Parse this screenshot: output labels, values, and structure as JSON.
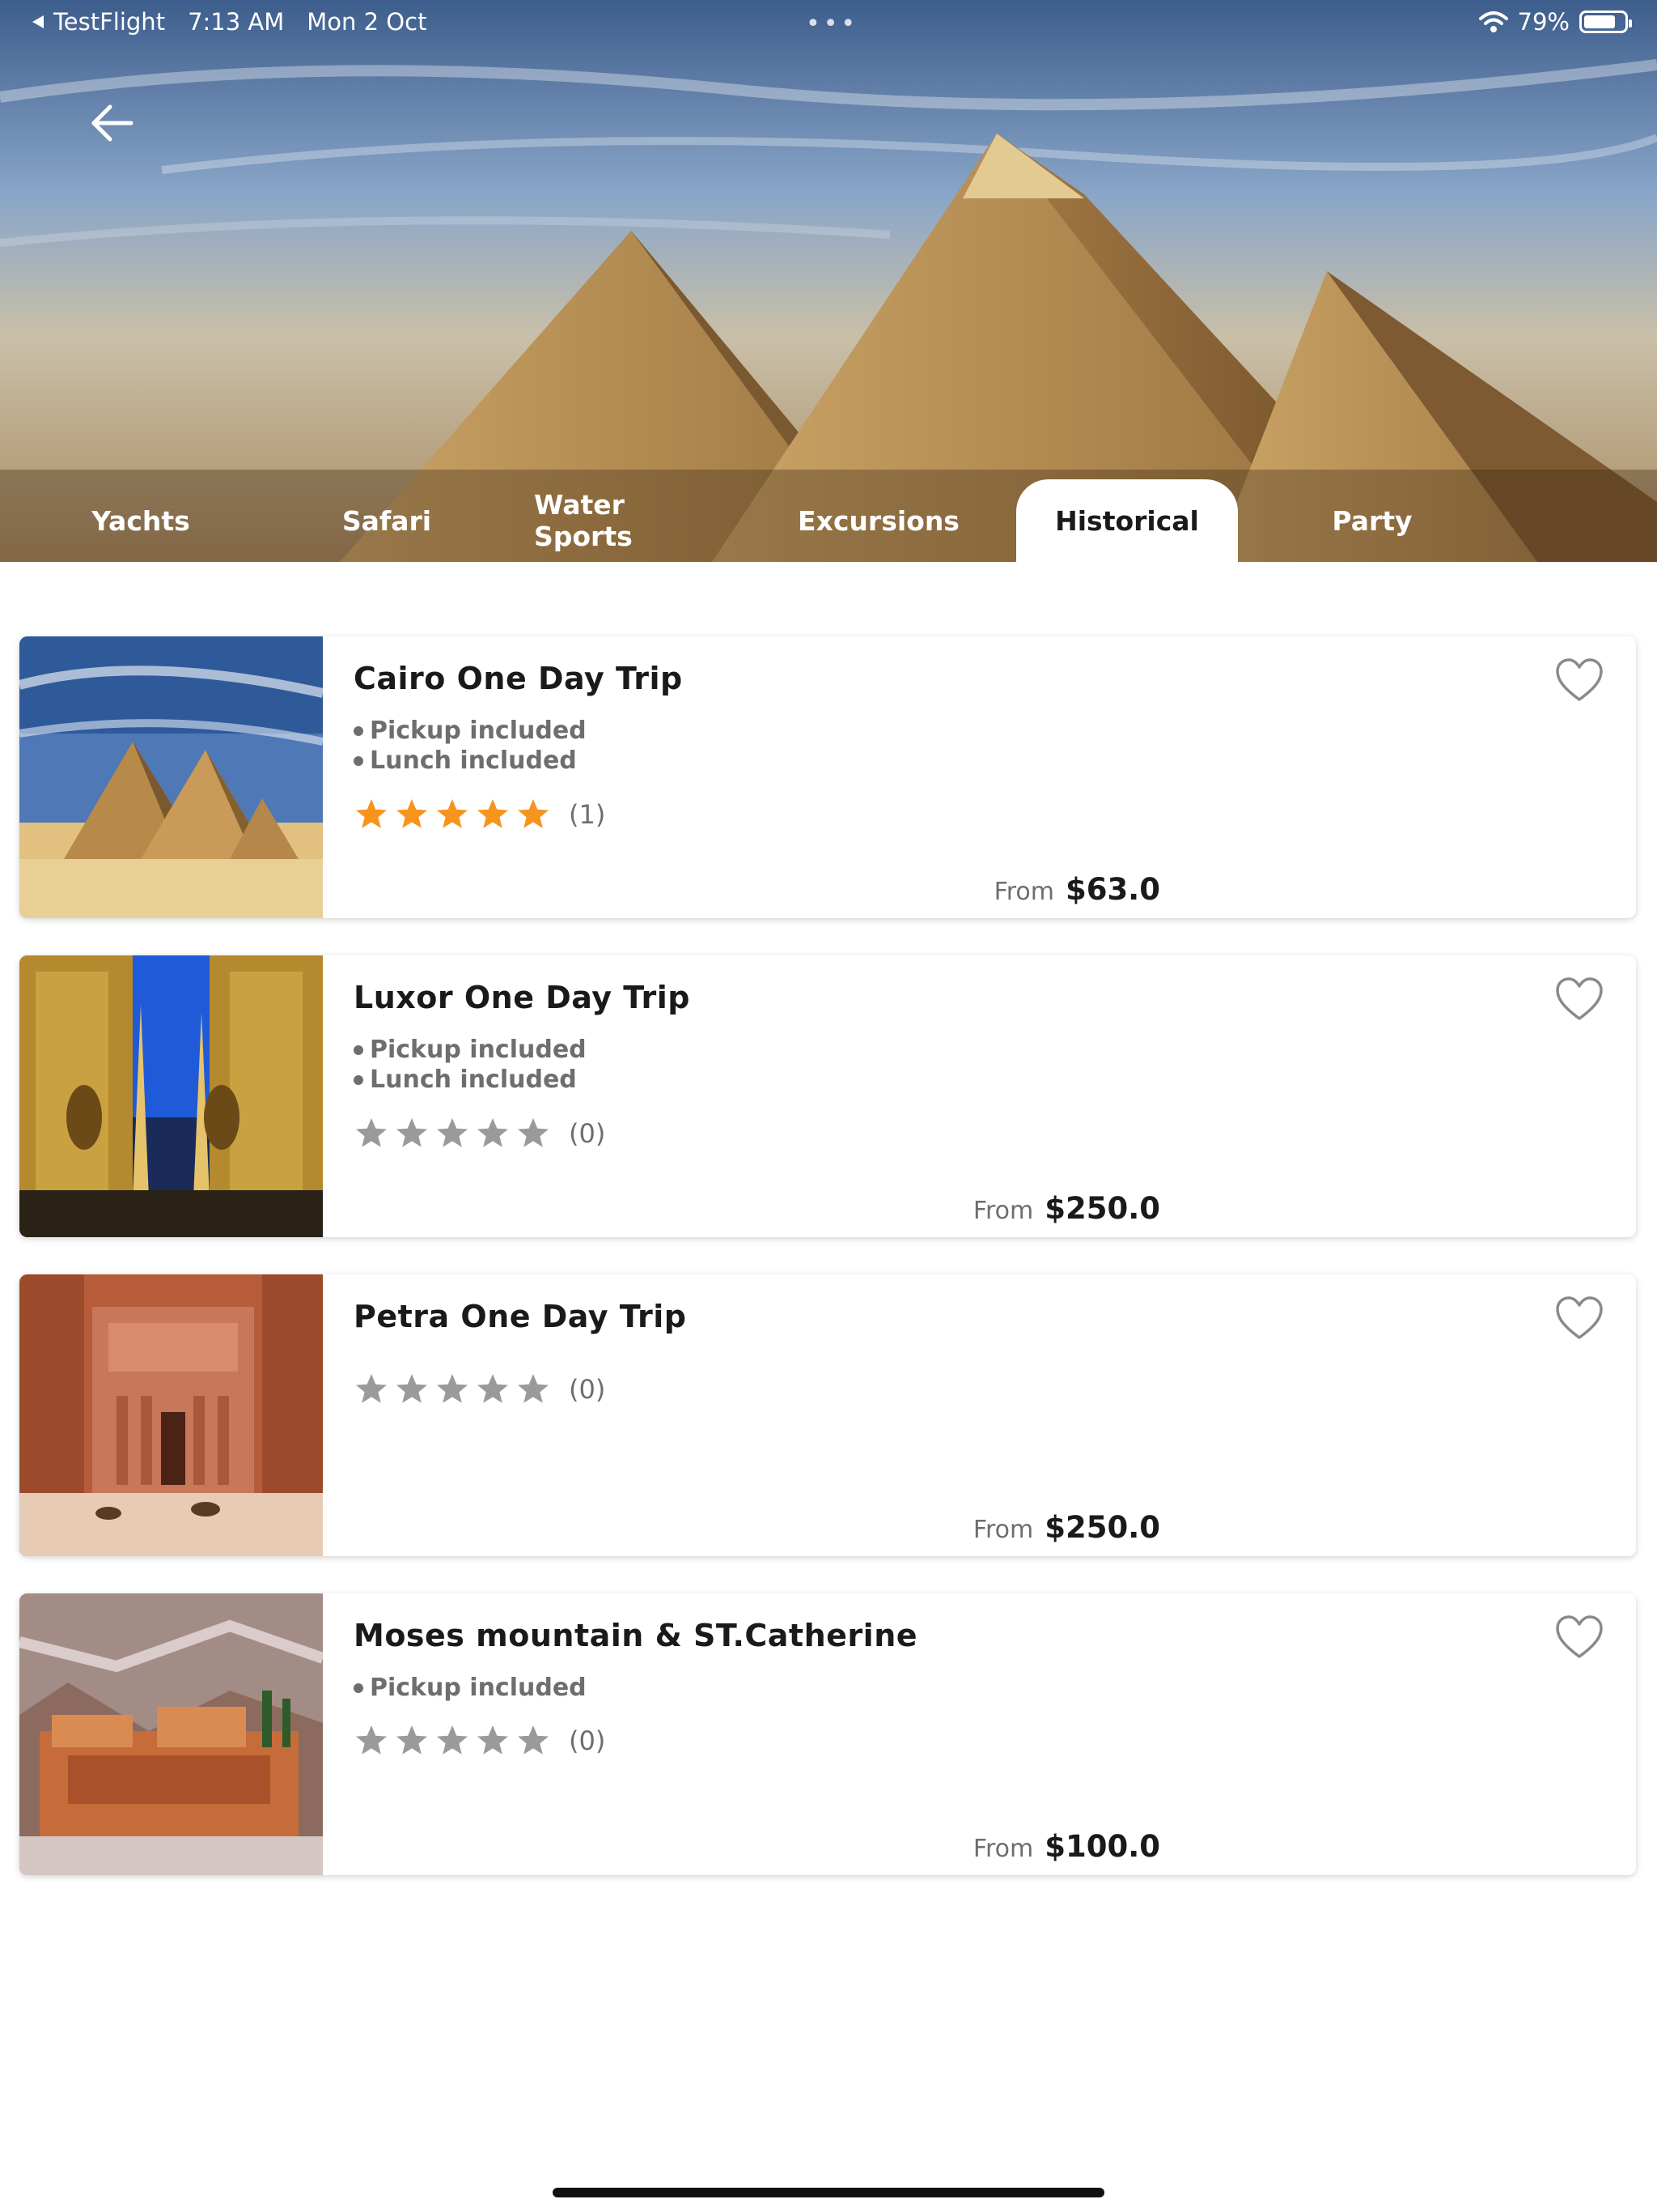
{
  "status_bar": {
    "back_app": "TestFlight",
    "time": "7:13 AM",
    "date": "Mon 2 Oct",
    "battery": "79%",
    "battery_level": 0.79
  },
  "icons": {
    "back": "arrow-left-icon",
    "favorite": "heart-outline-icon",
    "star": "star-icon",
    "wifi": "wifi-icon",
    "battery": "battery-icon"
  },
  "colors": {
    "star_active": "#f7941d",
    "star_inactive": "#9a9a9a",
    "text_muted": "#6e6e6e",
    "tab_active_bg": "#ffffff"
  },
  "tabs": [
    {
      "label": "Yachts",
      "active": false
    },
    {
      "label": "Safari",
      "active": false
    },
    {
      "label": "Water Sports",
      "active": false
    },
    {
      "label": "Excursions",
      "active": false
    },
    {
      "label": "Historical",
      "active": true
    },
    {
      "label": "Party",
      "active": false
    }
  ],
  "trips": [
    {
      "title": "Cairo One Day Trip",
      "features": [
        "Pickup included",
        "Lunch included"
      ],
      "rating": 5,
      "rating_count": "(1)",
      "price_from": "From",
      "price": "$63.0",
      "image": "pyramids-desert"
    },
    {
      "title": "Luxor One Day Trip",
      "features": [
        "Pickup included",
        "Lunch included"
      ],
      "rating": 0,
      "rating_count": "(0)",
      "price_from": "From",
      "price": "$250.0",
      "image": "luxor-temple-night"
    },
    {
      "title": "Petra One Day Trip",
      "features": [],
      "rating": 0,
      "rating_count": "(0)",
      "price_from": "From",
      "price": "$250.0",
      "image": "petra-treasury"
    },
    {
      "title": "Moses mountain & ST.Catherine",
      "features": [
        "Pickup included"
      ],
      "rating": 0,
      "rating_count": "(0)",
      "price_from": "From",
      "price": "$100.0",
      "image": "st-catherine-monastery"
    }
  ]
}
